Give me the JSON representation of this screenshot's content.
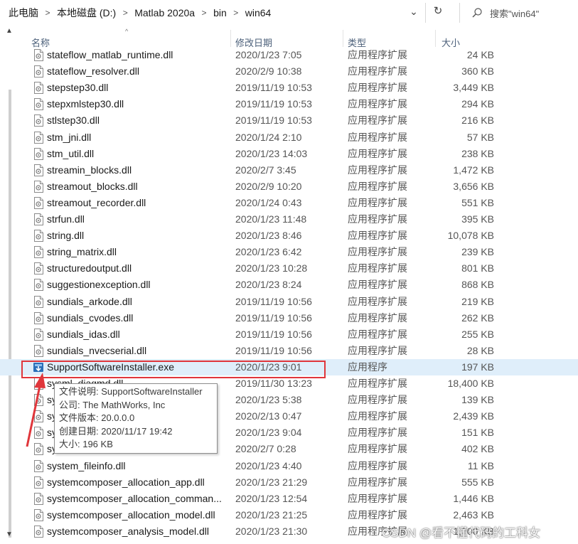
{
  "address": {
    "breadcrumbs": [
      "此电脑",
      "本地磁盘 (D:)",
      "Matlab 2020a",
      "bin",
      "win64"
    ],
    "separator": ">",
    "dropdown_glyph": "⌄",
    "refresh_glyph": "↻"
  },
  "search": {
    "placeholder": "搜索\"win64\""
  },
  "columns": {
    "name": "名称",
    "date": "修改日期",
    "type": "类型",
    "size": "大小"
  },
  "files": [
    {
      "name": "stateflow_matlab_runtime.dll",
      "date": "2020/1/23 7:05",
      "type": "应用程序扩展",
      "size": "24 KB",
      "icon": "dll-icon"
    },
    {
      "name": "stateflow_resolver.dll",
      "date": "2020/2/9 10:38",
      "type": "应用程序扩展",
      "size": "360 KB",
      "icon": "dll-icon"
    },
    {
      "name": "stepstep30.dll",
      "date": "2019/11/19 10:53",
      "type": "应用程序扩展",
      "size": "3,449 KB",
      "icon": "dll-icon"
    },
    {
      "name": "stepxmlstep30.dll",
      "date": "2019/11/19 10:53",
      "type": "应用程序扩展",
      "size": "294 KB",
      "icon": "dll-icon"
    },
    {
      "name": "stlstep30.dll",
      "date": "2019/11/19 10:53",
      "type": "应用程序扩展",
      "size": "216 KB",
      "icon": "dll-icon"
    },
    {
      "name": "stm_jni.dll",
      "date": "2020/1/24 2:10",
      "type": "应用程序扩展",
      "size": "57 KB",
      "icon": "dll-icon"
    },
    {
      "name": "stm_util.dll",
      "date": "2020/1/23 14:03",
      "type": "应用程序扩展",
      "size": "238 KB",
      "icon": "dll-icon"
    },
    {
      "name": "streamin_blocks.dll",
      "date": "2020/2/7 3:45",
      "type": "应用程序扩展",
      "size": "1,472 KB",
      "icon": "dll-icon"
    },
    {
      "name": "streamout_blocks.dll",
      "date": "2020/2/9 10:20",
      "type": "应用程序扩展",
      "size": "3,656 KB",
      "icon": "dll-icon"
    },
    {
      "name": "streamout_recorder.dll",
      "date": "2020/1/24 0:43",
      "type": "应用程序扩展",
      "size": "551 KB",
      "icon": "dll-icon"
    },
    {
      "name": "strfun.dll",
      "date": "2020/1/23 11:48",
      "type": "应用程序扩展",
      "size": "395 KB",
      "icon": "dll-icon"
    },
    {
      "name": "string.dll",
      "date": "2020/1/23 8:46",
      "type": "应用程序扩展",
      "size": "10,078 KB",
      "icon": "dll-icon"
    },
    {
      "name": "string_matrix.dll",
      "date": "2020/1/23 6:42",
      "type": "应用程序扩展",
      "size": "239 KB",
      "icon": "dll-icon"
    },
    {
      "name": "structuredoutput.dll",
      "date": "2020/1/23 10:28",
      "type": "应用程序扩展",
      "size": "801 KB",
      "icon": "dll-icon"
    },
    {
      "name": "suggestionexception.dll",
      "date": "2020/1/23 8:24",
      "type": "应用程序扩展",
      "size": "868 KB",
      "icon": "dll-icon"
    },
    {
      "name": "sundials_arkode.dll",
      "date": "2019/11/19 10:56",
      "type": "应用程序扩展",
      "size": "219 KB",
      "icon": "dll-icon"
    },
    {
      "name": "sundials_cvodes.dll",
      "date": "2019/11/19 10:56",
      "type": "应用程序扩展",
      "size": "262 KB",
      "icon": "dll-icon"
    },
    {
      "name": "sundials_idas.dll",
      "date": "2019/11/19 10:56",
      "type": "应用程序扩展",
      "size": "255 KB",
      "icon": "dll-icon"
    },
    {
      "name": "sundials_nvecserial.dll",
      "date": "2019/11/19 10:56",
      "type": "应用程序扩展",
      "size": "28 KB",
      "icon": "dll-icon"
    },
    {
      "name": "SupportSoftwareInstaller.exe",
      "date": "2020/1/23 9:01",
      "type": "应用程序",
      "size": "197 KB",
      "icon": "installer-exe-icon",
      "selected": true
    },
    {
      "name": "sysml_diagmd.dll",
      "date": "2019/11/30 13:23",
      "type": "应用程序扩展",
      "size": "18,400 KB",
      "icon": "dll-icon"
    },
    {
      "name": "sy",
      "date": "2020/1/23 5:38",
      "type": "应用程序扩展",
      "size": "139 KB",
      "icon": "dll-icon"
    },
    {
      "name": "sy",
      "date": "2020/2/13 0:47",
      "type": "应用程序扩展",
      "size": "2,439 KB",
      "icon": "dll-icon"
    },
    {
      "name": "sy",
      "date": "2020/1/23 9:04",
      "type": "应用程序扩展",
      "size": "151 KB",
      "icon": "dll-icon"
    },
    {
      "name": "sy",
      "date": "2020/2/7 0:28",
      "type": "应用程序扩展",
      "size": "402 KB",
      "icon": "dll-icon"
    },
    {
      "name": "system_fileinfo.dll",
      "date": "2020/1/23 4:40",
      "type": "应用程序扩展",
      "size": "11 KB",
      "icon": "dll-icon"
    },
    {
      "name": "systemcomposer_allocation_app.dll",
      "date": "2020/1/23 21:29",
      "type": "应用程序扩展",
      "size": "555 KB",
      "icon": "dll-icon"
    },
    {
      "name": "systemcomposer_allocation_comman...",
      "date": "2020/1/23 12:54",
      "type": "应用程序扩展",
      "size": "1,446 KB",
      "icon": "dll-icon"
    },
    {
      "name": "systemcomposer_allocation_model.dll",
      "date": "2020/1/23 21:25",
      "type": "应用程序扩展",
      "size": "2,463 KB",
      "icon": "dll-icon"
    },
    {
      "name": "systemcomposer_analysis_model.dll",
      "date": "2020/1/23 21:30",
      "type": "应用程序扩展",
      "size": "1,300 KB",
      "icon": "dll-icon"
    }
  ],
  "tooltip": {
    "lines": [
      "文件说明: SupportSoftwareInstaller",
      "公司: The MathWorks, Inc",
      "文件版本: 20.0.0.0",
      "创建日期: 2020/11/17 19:42",
      "大小: 196 KB"
    ]
  },
  "watermark": "CSDN @看不懂代码的工科女",
  "colors": {
    "annotation_red": "#e0363b",
    "selection": "#dfeefa",
    "header_text": "#4c607a"
  }
}
